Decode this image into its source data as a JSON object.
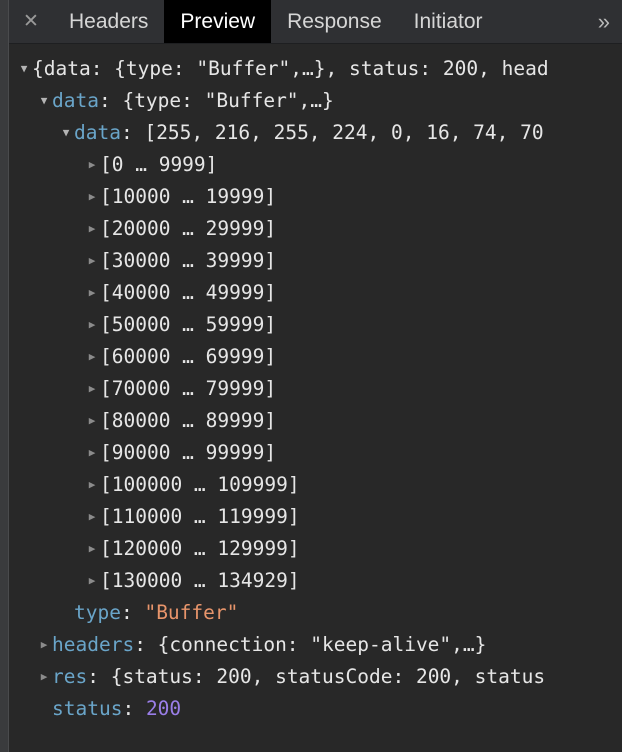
{
  "tabbar": {
    "close_icon": "close-icon",
    "close_glyph": "✕",
    "overflow_glyph": "»",
    "tabs": [
      {
        "label": "Headers",
        "active": false
      },
      {
        "label": "Preview",
        "active": true
      },
      {
        "label": "Response",
        "active": false
      },
      {
        "label": "Initiator",
        "active": false
      }
    ]
  },
  "colors": {
    "panel_bg": "#282828",
    "tabbar_bg": "#2f3033",
    "active_tab_bg": "#000000",
    "key": "#6aa5c9",
    "string": "#e8956b",
    "number": "#9a7ee8",
    "plain": "#e6e6e6",
    "arrow": "#8b8b8b"
  },
  "tree": {
    "rows": [
      {
        "indent": 0,
        "arrow": "open",
        "parts": [
          {
            "t": "{data: {type: \"Buffer\",…}, status: 200, head",
            "c": "p"
          }
        ]
      },
      {
        "indent": 1,
        "arrow": "open",
        "parts": [
          {
            "t": "data",
            "c": "k"
          },
          {
            "t": ": {type: \"Buffer\",…}",
            "c": "p"
          }
        ]
      },
      {
        "indent": 2,
        "arrow": "open",
        "parts": [
          {
            "t": "data",
            "c": "k"
          },
          {
            "t": ": [255, 216, 255, 224, 0, 16, 74, 70",
            "c": "p"
          }
        ]
      },
      {
        "indent": 3,
        "arrow": "collapsed",
        "parts": [
          {
            "t": "[0 … 9999]",
            "c": "p"
          }
        ]
      },
      {
        "indent": 3,
        "arrow": "collapsed",
        "parts": [
          {
            "t": "[10000 … 19999]",
            "c": "p"
          }
        ]
      },
      {
        "indent": 3,
        "arrow": "collapsed",
        "parts": [
          {
            "t": "[20000 … 29999]",
            "c": "p"
          }
        ]
      },
      {
        "indent": 3,
        "arrow": "collapsed",
        "parts": [
          {
            "t": "[30000 … 39999]",
            "c": "p"
          }
        ]
      },
      {
        "indent": 3,
        "arrow": "collapsed",
        "parts": [
          {
            "t": "[40000 … 49999]",
            "c": "p"
          }
        ]
      },
      {
        "indent": 3,
        "arrow": "collapsed",
        "parts": [
          {
            "t": "[50000 … 59999]",
            "c": "p"
          }
        ]
      },
      {
        "indent": 3,
        "arrow": "collapsed",
        "parts": [
          {
            "t": "[60000 … 69999]",
            "c": "p"
          }
        ]
      },
      {
        "indent": 3,
        "arrow": "collapsed",
        "parts": [
          {
            "t": "[70000 … 79999]",
            "c": "p"
          }
        ]
      },
      {
        "indent": 3,
        "arrow": "collapsed",
        "parts": [
          {
            "t": "[80000 … 89999]",
            "c": "p"
          }
        ]
      },
      {
        "indent": 3,
        "arrow": "collapsed",
        "parts": [
          {
            "t": "[90000 … 99999]",
            "c": "p"
          }
        ]
      },
      {
        "indent": 3,
        "arrow": "collapsed",
        "parts": [
          {
            "t": "[100000 … 109999]",
            "c": "p"
          }
        ]
      },
      {
        "indent": 3,
        "arrow": "collapsed",
        "parts": [
          {
            "t": "[110000 … 119999]",
            "c": "p"
          }
        ]
      },
      {
        "indent": 3,
        "arrow": "collapsed",
        "parts": [
          {
            "t": "[120000 … 129999]",
            "c": "p"
          }
        ]
      },
      {
        "indent": 3,
        "arrow": "collapsed",
        "parts": [
          {
            "t": "[130000 … 134929]",
            "c": "p"
          }
        ]
      },
      {
        "indent": 2,
        "arrow": "none",
        "parts": [
          {
            "t": "type",
            "c": "k"
          },
          {
            "t": ": ",
            "c": "p"
          },
          {
            "t": "\"Buffer\"",
            "c": "str"
          }
        ]
      },
      {
        "indent": 1,
        "arrow": "collapsed",
        "parts": [
          {
            "t": "headers",
            "c": "k"
          },
          {
            "t": ": {connection: \"keep-alive\",…}",
            "c": "p"
          }
        ]
      },
      {
        "indent": 1,
        "arrow": "collapsed",
        "parts": [
          {
            "t": "res",
            "c": "k"
          },
          {
            "t": ": {status: 200, statusCode: 200, status",
            "c": "p"
          }
        ]
      },
      {
        "indent": 1,
        "arrow": "none",
        "parts": [
          {
            "t": "status",
            "c": "k"
          },
          {
            "t": ": ",
            "c": "p"
          },
          {
            "t": "200",
            "c": "num"
          }
        ]
      }
    ]
  }
}
